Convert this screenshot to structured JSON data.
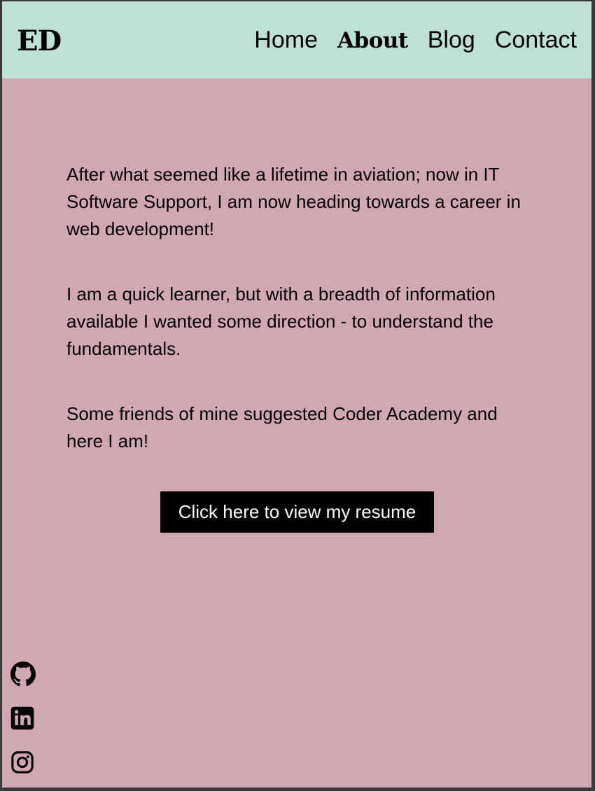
{
  "header": {
    "logo": "ED",
    "nav": [
      {
        "label": "Home",
        "active": false
      },
      {
        "label": "About",
        "active": true
      },
      {
        "label": "Blog",
        "active": false
      },
      {
        "label": "Contact",
        "active": false
      }
    ]
  },
  "main": {
    "paragraphs": [
      "After what seemed like a lifetime in aviation; now in IT Software Support, I am now heading towards a career in web development!",
      "I am a quick learner, but with a breadth of information available I wanted some direction - to understand the fundamentals.",
      "Some friends of mine suggested Coder Academy and here I am!"
    ],
    "resume_button": "Click here to view my resume"
  },
  "social": [
    {
      "icon": "github-icon"
    },
    {
      "icon": "linkedin-icon"
    },
    {
      "icon": "instagram-icon"
    }
  ],
  "colors": {
    "header_bg": "#bfe0d4",
    "page_bg": "#d1a8b2",
    "button_bg": "#000000",
    "button_text": "#ffffff"
  }
}
